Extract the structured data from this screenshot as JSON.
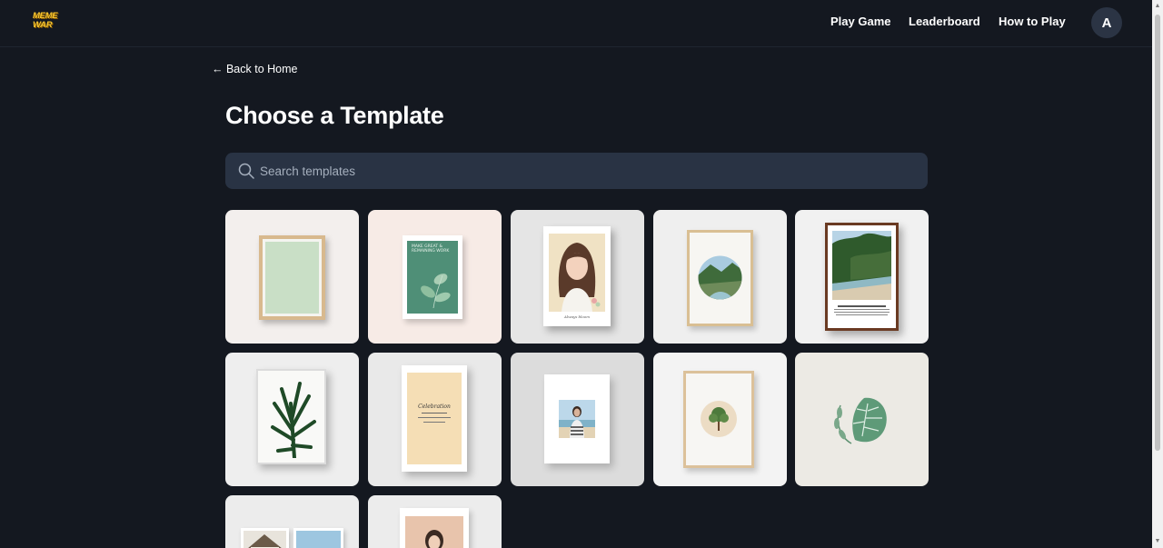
{
  "header": {
    "logo_line1": "MEME",
    "logo_line2": "WAR",
    "nav": [
      "Play Game",
      "Leaderboard",
      "How to Play"
    ],
    "avatar_initial": "A"
  },
  "back_link": "← Back to Home",
  "page_title": "Choose a Template",
  "search": {
    "placeholder": "Search templates",
    "value": ""
  },
  "colors": {
    "background": "#141820",
    "search_bg": "#293344",
    "logo": "#f4c430"
  },
  "templates": [
    {
      "name": "light wood frame with green mat"
    },
    {
      "name": "green botanical poster",
      "text": "MAKE GREAT & REMAINING WORK"
    },
    {
      "name": "girl portrait illustration",
      "text": "Always bloom"
    },
    {
      "name": "wooden frame with circular landscape"
    },
    {
      "name": "brown frame beach landscape"
    },
    {
      "name": "white frame palm leaf"
    },
    {
      "name": "beige invitation card",
      "text": "Celebration"
    },
    {
      "name": "white frame beach portrait"
    },
    {
      "name": "wooden frame with tree circle"
    },
    {
      "name": "green leaf wreath"
    },
    {
      "name": "house photo frames"
    },
    {
      "name": "portrait in white frame"
    }
  ]
}
